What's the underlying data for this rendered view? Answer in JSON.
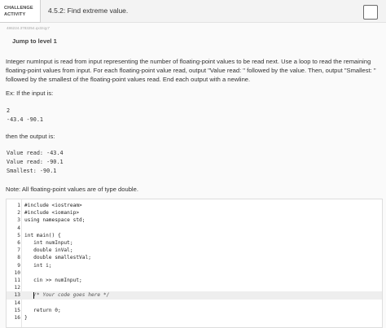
{
  "header": {
    "badge_line1": "CHALLENGE",
    "badge_line2": "ACTIVITY",
    "title": "4.5.2: Find extreme value."
  },
  "activity_id": "486224.3783254.qx3zqy7",
  "jump_link": "Jump to level 1",
  "description": "Integer numInput is read from input representing the number of floating-point values to be read next. Use a loop to read the remaining floating-point values from input. For each floating-point value read, output \"Value read: \" followed by the value. Then, output \"Smallest: \" followed by the smallest of the floating-point values read. End each output with a newline.",
  "example_intro": "Ex: If the input is:",
  "example_input": [
    "2",
    "-43.4 -90.1"
  ],
  "then_text": "then the output is:",
  "example_output": [
    "Value read: -43.4",
    "Value read: -90.1",
    "Smallest: -90.1"
  ],
  "note": "Note: All floating-point values are of type double.",
  "editor": {
    "lines": [
      {
        "num": "1",
        "text": "#include <iostream>"
      },
      {
        "num": "2",
        "text": "#include <iomanip>"
      },
      {
        "num": "3",
        "text": "using namespace std;"
      },
      {
        "num": "4",
        "text": ""
      },
      {
        "num": "5",
        "text": "int main() {"
      },
      {
        "num": "6",
        "text": "   int numInput;"
      },
      {
        "num": "7",
        "text": "   double inVal;"
      },
      {
        "num": "8",
        "text": "   double smallestVal;"
      },
      {
        "num": "9",
        "text": "   int i;"
      },
      {
        "num": "10",
        "text": ""
      },
      {
        "num": "11",
        "text": "   cin >> numInput;"
      },
      {
        "num": "12",
        "text": ""
      },
      {
        "num": "13",
        "text": "   /* Your code goes here */"
      },
      {
        "num": "14",
        "text": ""
      },
      {
        "num": "15",
        "text": "   return 0;"
      },
      {
        "num": "16",
        "text": "}"
      }
    ]
  }
}
